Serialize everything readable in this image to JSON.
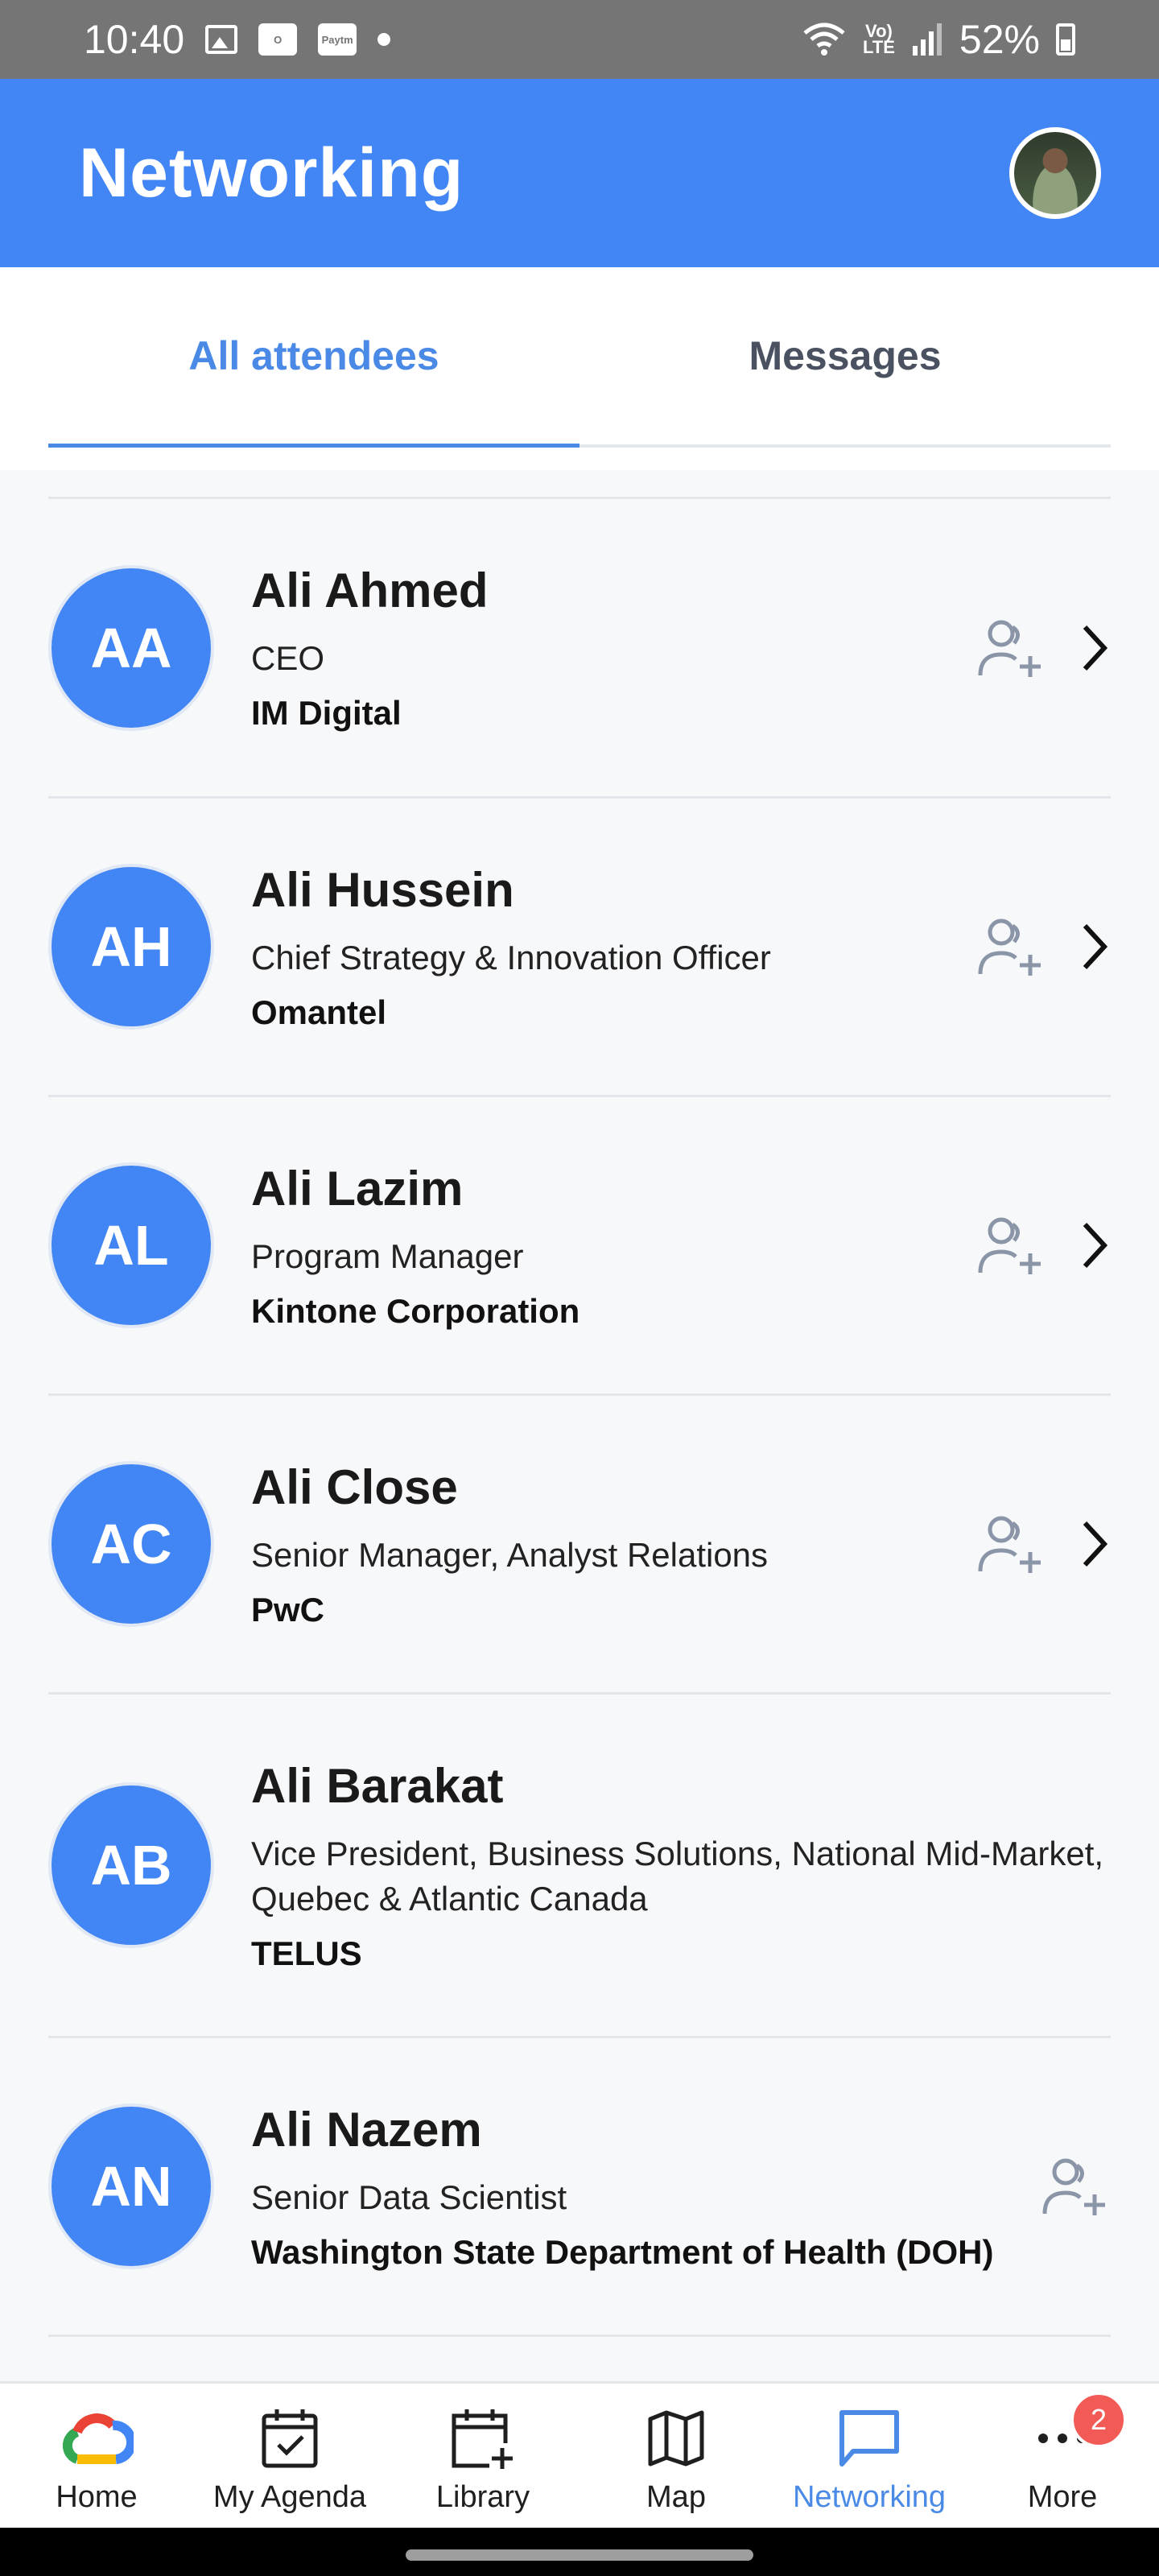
{
  "status_bar": {
    "time": "10:40",
    "paytm": "Paytm",
    "network": "LTE",
    "battery": "52%"
  },
  "header": {
    "title": "Networking"
  },
  "tabs": [
    {
      "label": "All attendees",
      "active": true
    },
    {
      "label": "Messages",
      "active": false
    }
  ],
  "attendees": [
    {
      "initials": "AA",
      "name": "Ali Ahmed",
      "title": "CEO",
      "company": "IM Digital"
    },
    {
      "initials": "AH",
      "name": "Ali Hussein",
      "title": "Chief Strategy & Innovation Officer",
      "company": "Omantel"
    },
    {
      "initials": "AL",
      "name": "Ali Lazim",
      "title": "Program Manager",
      "company": "Kintone Corporation"
    },
    {
      "initials": "AC",
      "name": "Ali Close",
      "title": "Senior Manager, Analyst Relations",
      "company": "PwC"
    },
    {
      "initials": "AB",
      "name": "Ali Barakat",
      "title": "Vice President, Business Solutions, National Mid-Market, Quebec & Atlantic Canada",
      "company": "TELUS"
    },
    {
      "initials": "AN",
      "name": "Ali Nazem",
      "title": "Senior Data Scientist",
      "company": "Washington State Department of Health (DOH)"
    }
  ],
  "bottom_nav": [
    {
      "label": "Home",
      "icon": "google-cloud-icon"
    },
    {
      "label": "My Agenda",
      "icon": "calendar-check-icon"
    },
    {
      "label": "Library",
      "icon": "calendar-add-icon"
    },
    {
      "label": "Map",
      "icon": "map-icon"
    },
    {
      "label": "Networking",
      "icon": "chat-icon",
      "active": true
    },
    {
      "label": "More",
      "icon": "more-dots-icon",
      "badge": "2"
    }
  ],
  "colors": {
    "primary": "#4285f4",
    "active_tab": "#4a8ae6",
    "badge": "#f25b55"
  }
}
